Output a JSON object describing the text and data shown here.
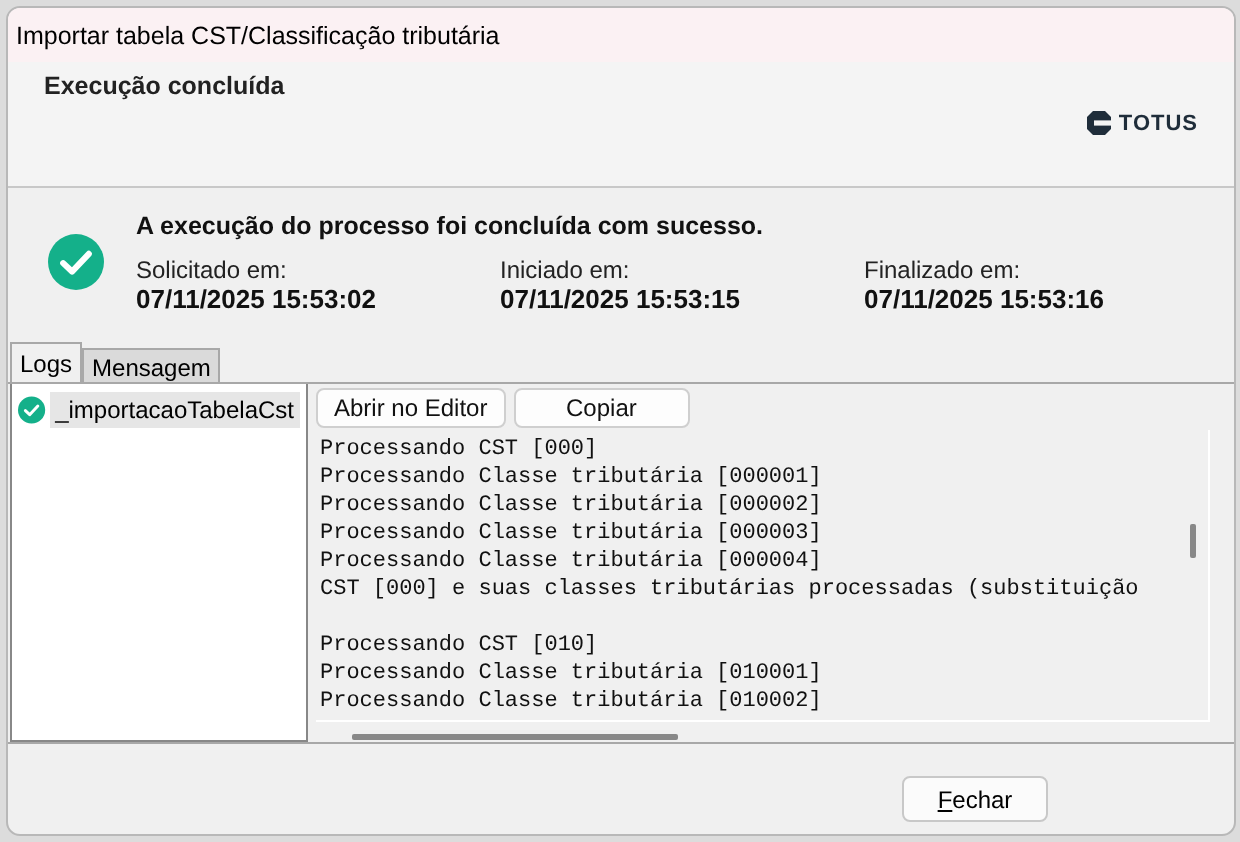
{
  "window": {
    "title": "Importar tabela CST/Classificação tributária"
  },
  "header": {
    "title": "Execução concluída",
    "logo": "TOTUS"
  },
  "result": {
    "message": "A execução do processo foi concluída com sucesso.",
    "times": [
      {
        "label": "Solicitado em:",
        "value": "07/11/2025 15:53:02"
      },
      {
        "label": "Iniciado em:",
        "value": "07/11/2025 15:53:15"
      },
      {
        "label": "Finalizado em:",
        "value": "07/11/2025 15:53:16"
      }
    ]
  },
  "tabs": [
    {
      "label": "Logs",
      "selected": true
    },
    {
      "label": "Mensagem",
      "selected": false
    }
  ],
  "log_tree": {
    "items": [
      {
        "label": "_importacaoTabelaCst",
        "selected": true
      }
    ]
  },
  "log_buttons": [
    "Abrir no Editor",
    "Copiar"
  ],
  "log_blocks": [
    [
      "Processando CST [000]",
      "Processando Classe tributária [000001]",
      "Processando Classe tributária [000002]",
      "Processando Classe tributária [000003]",
      "Processando Classe tributária [000004]",
      "CST [000] e suas classes tributárias processadas (substituição"
    ],
    [
      "Processando CST [010]",
      "Processando Classe tributária [010001]",
      "Processando Classe tributária [010002]"
    ]
  ],
  "buttons": [
    "Fechar"
  ]
}
